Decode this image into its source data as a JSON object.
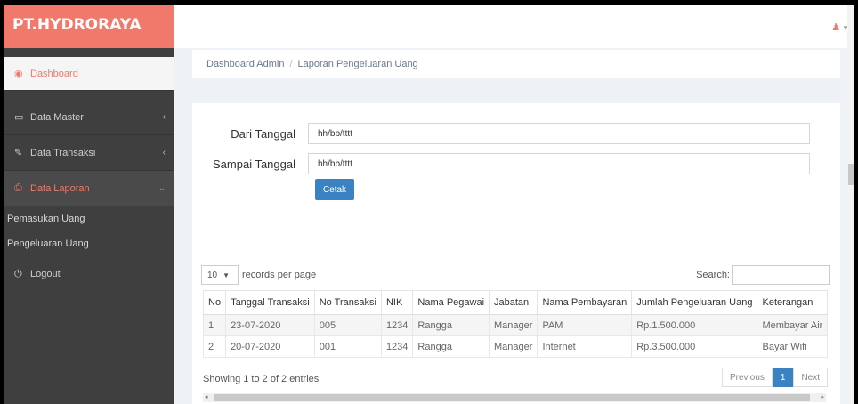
{
  "brand": {
    "name": "PT.HYDRORAYA"
  },
  "sidebar": {
    "items": [
      {
        "label": "Dashboard",
        "icon": "dashboard-icon",
        "glyph": "◉"
      },
      {
        "label": "Data Master",
        "icon": "monitor-icon",
        "glyph": "▭"
      },
      {
        "label": "Data Transaksi",
        "icon": "edit-icon",
        "glyph": "✎"
      },
      {
        "label": "Data Laporan",
        "icon": "print-icon",
        "glyph": "⎙"
      },
      {
        "label": "Logout",
        "icon": "power-icon",
        "glyph": "⏻"
      }
    ],
    "sub_items": [
      "Pemasukan Uang",
      "Pengeluaran Uang"
    ],
    "caret": "‹",
    "caret_open": "⌄"
  },
  "topbar": {
    "user_icon": "user-icon",
    "user_glyph": "♟",
    "caret": "▼"
  },
  "breadcrumb": {
    "home": "Dashboard Admin",
    "separator": "/",
    "current": "Laporan Pengeluaran Uang"
  },
  "form": {
    "from_label": "Dari Tanggal",
    "from_value": "hh/bb/tttt",
    "to_label": "Sampai Tanggal",
    "to_value": "hh/bb/tttt",
    "print_button": "Cetak"
  },
  "datatable": {
    "length_value": "10",
    "length_caret": "▼",
    "length_suffix": "records per page",
    "search_label": "Search:",
    "columns": [
      "No",
      "Tanggal Transaksi",
      "No Transaksi",
      "NIK",
      "Nama Pegawai",
      "Jabatan",
      "Nama Pembayaran",
      "Jumlah Pengeluaran Uang",
      "Keterangan"
    ],
    "rows": [
      [
        "1",
        "23-07-2020",
        "005",
        "1234",
        "Rangga",
        "Manager",
        "PAM",
        "Rp.1.500.000",
        "Membayar Air"
      ],
      [
        "2",
        "20-07-2020",
        "001",
        "1234",
        "Rangga",
        "Manager",
        "Internet",
        "Rp.3.500.000",
        "Bayar Wifi"
      ]
    ],
    "info": "Showing 1 to 2 of 2 entries",
    "pagination": {
      "previous": "Previous",
      "current": "1",
      "next": "Next"
    },
    "scroll_left": "◂",
    "scroll_right": "▸"
  },
  "colors": {
    "accent": "#f0796b",
    "primary": "#3a82c2",
    "sidebar": "#3f3f3f"
  }
}
